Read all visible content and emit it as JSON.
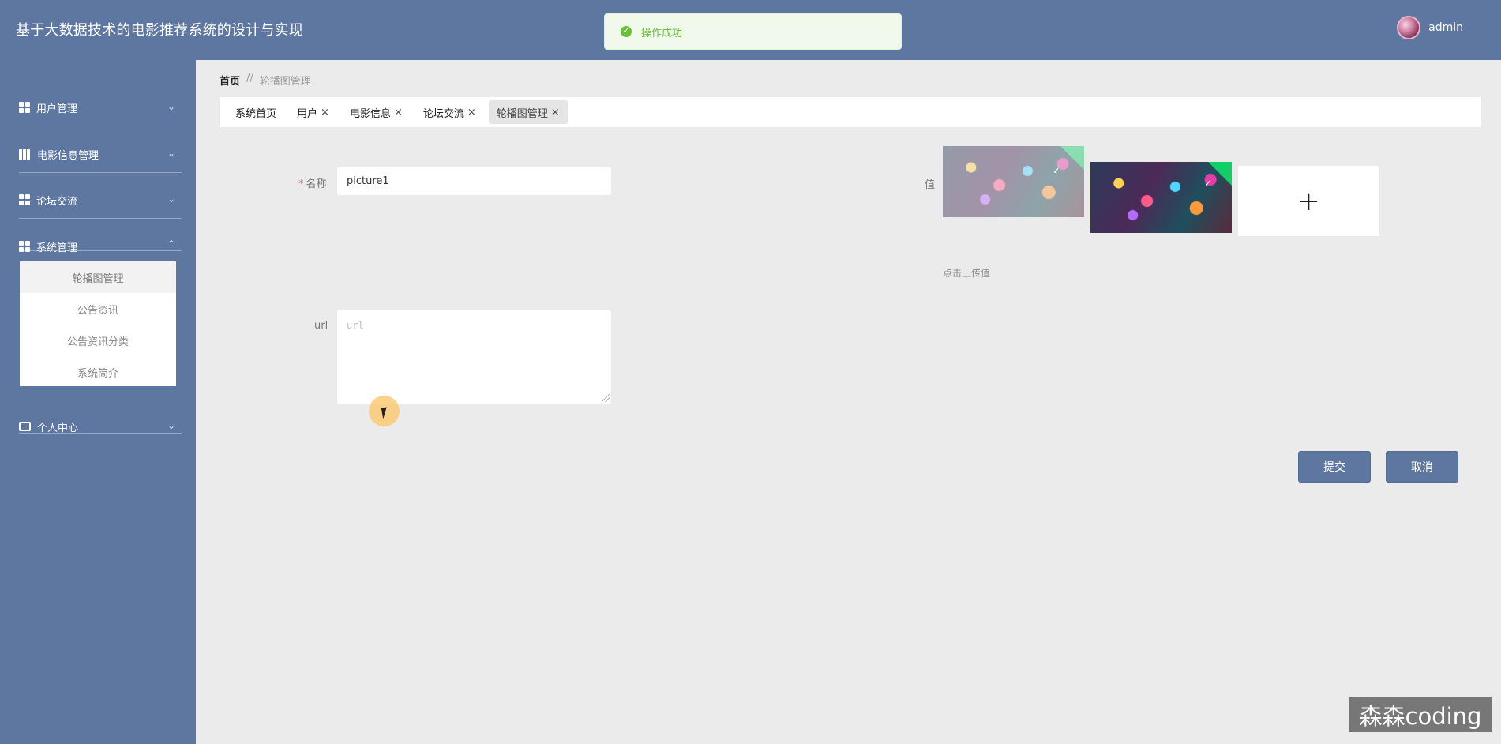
{
  "header": {
    "title": "基于大数据技术的电影推荐系统的设计与实现",
    "username": "admin"
  },
  "toast": {
    "message": "操作成功"
  },
  "sidebar": {
    "items": [
      {
        "label": "用户管理",
        "icon": "grid-icon",
        "expanded": false
      },
      {
        "label": "电影信息管理",
        "icon": "bookshelf-icon",
        "expanded": false
      },
      {
        "label": "论坛交流",
        "icon": "grid-icon",
        "expanded": false
      },
      {
        "label": "系统管理",
        "icon": "grid-icon",
        "expanded": true
      },
      {
        "label": "个人中心",
        "icon": "card-icon",
        "expanded": false
      }
    ],
    "submenu": [
      {
        "label": "轮播图管理",
        "active": true
      },
      {
        "label": "公告资讯",
        "active": false
      },
      {
        "label": "公告资讯分类",
        "active": false
      },
      {
        "label": "系统简介",
        "active": false
      }
    ]
  },
  "breadcrumb": {
    "home": "首页",
    "separator": "//",
    "current": "轮播图管理"
  },
  "tabs": [
    {
      "label": "系统首页",
      "closable": false,
      "active": false
    },
    {
      "label": "用户",
      "closable": true,
      "active": false
    },
    {
      "label": "电影信息",
      "closable": true,
      "active": false
    },
    {
      "label": "论坛交流",
      "closable": true,
      "active": false
    },
    {
      "label": "轮播图管理",
      "closable": true,
      "active": true
    }
  ],
  "form": {
    "name_label": "名称",
    "name_required_mark": "*",
    "name_value": "picture1",
    "url_label": "url",
    "url_placeholder": "url",
    "value_label": "值",
    "upload_hint": "点击上传值",
    "upload_plus": "+",
    "close_glyph": "×",
    "check_glyph": "✓",
    "submit_label": "提交",
    "cancel_label": "取消"
  },
  "watermark": {
    "text": "森森coding"
  },
  "colors": {
    "primary": "#5e77a0",
    "background": "#ebebeb",
    "success": "#67c23a",
    "required": "#f56c6c"
  }
}
